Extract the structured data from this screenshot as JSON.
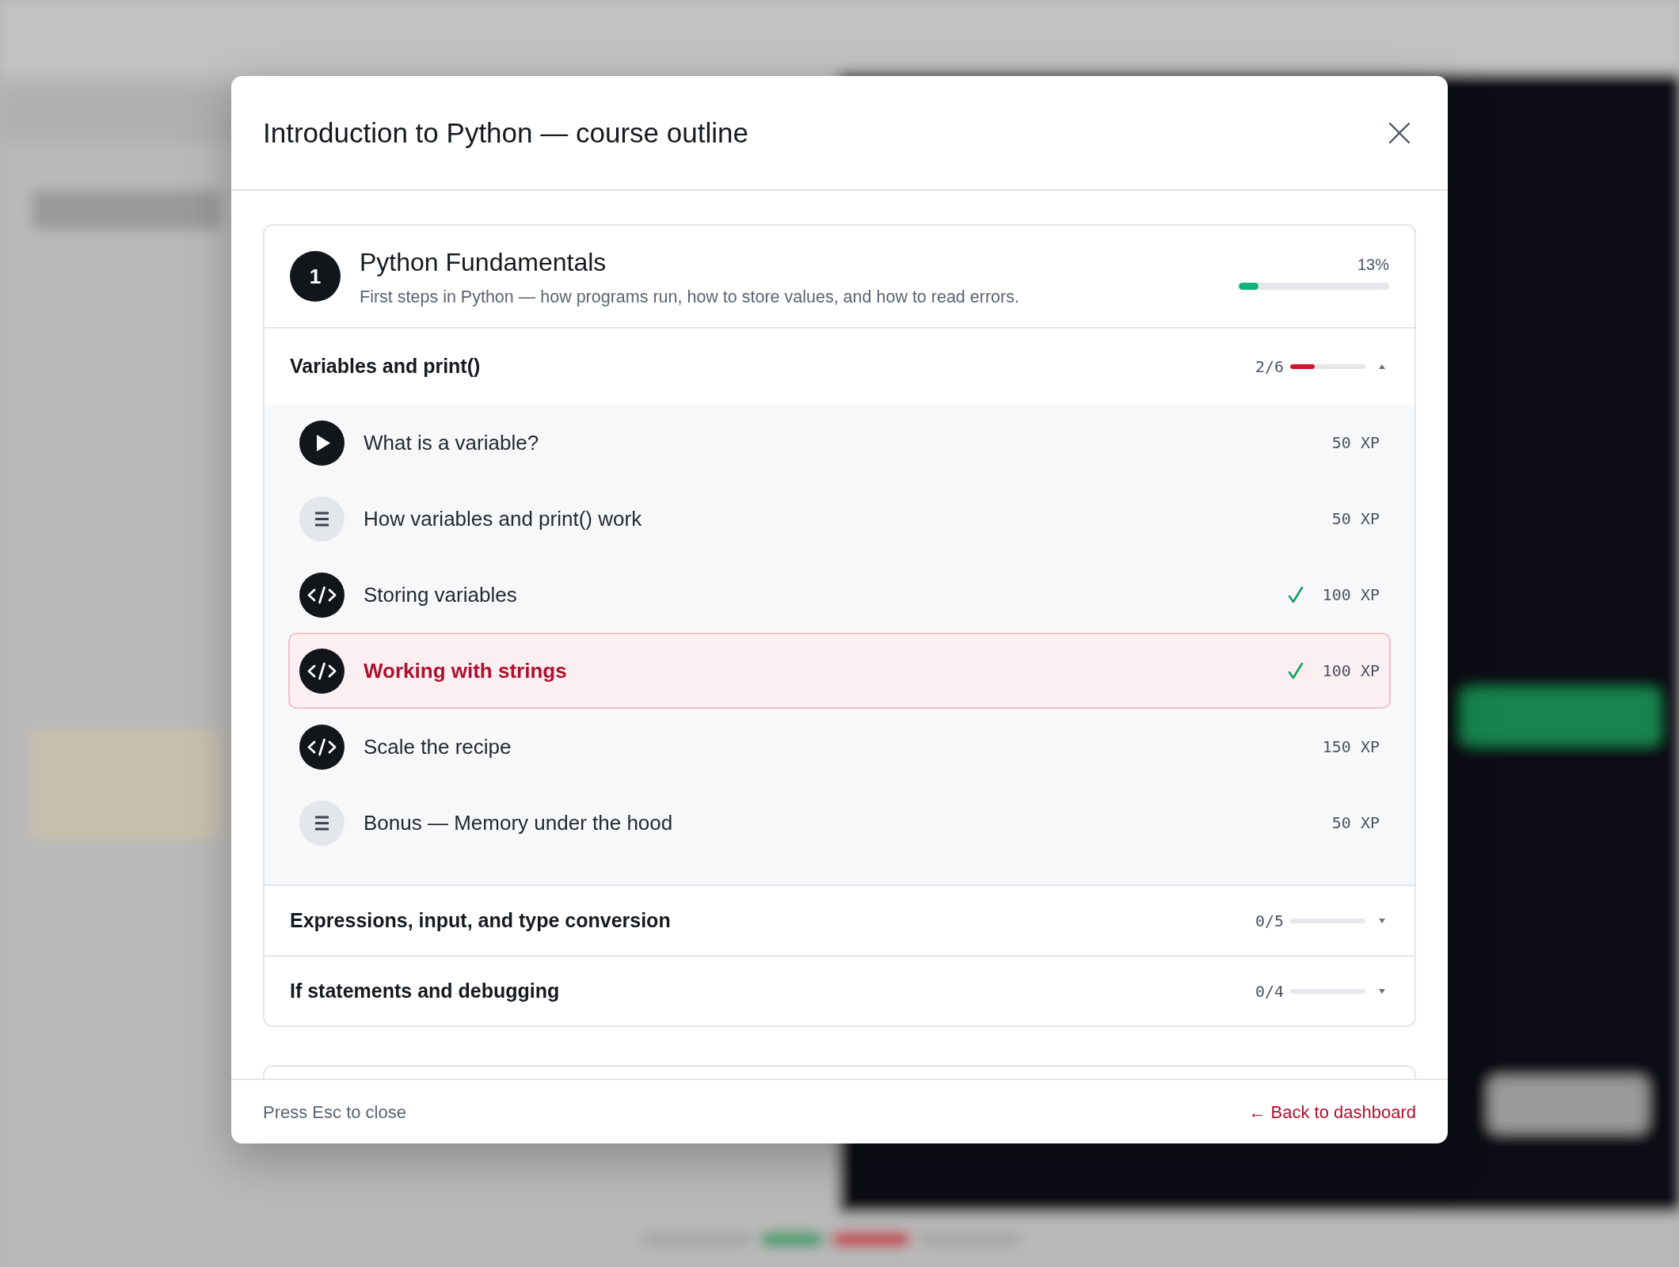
{
  "modal": {
    "title": "Introduction to Python — course outline",
    "footer_hint": "Press Esc to close",
    "footer_link": "← Back to dashboard"
  },
  "chapters": [
    {
      "number": "1",
      "title": "Python Fundamentals",
      "description": "First steps in Python — how programs run, how to store values, and how to read errors.",
      "percent": "13%",
      "level": 0.13,
      "sections": [
        {
          "title": "Variables and print()",
          "count": "2/6",
          "level": 0.33,
          "expanded": true,
          "lessons": [
            {
              "kind": "video",
              "title": "What is a variable?",
              "xp": "50 XP",
              "completed": false,
              "selected": false
            },
            {
              "kind": "article",
              "title": "How variables and print() work",
              "xp": "50 XP",
              "completed": false,
              "selected": false
            },
            {
              "kind": "exercise",
              "title": "Storing variables",
              "xp": "100 XP",
              "completed": true,
              "selected": false
            },
            {
              "kind": "exercise",
              "title": "Working with strings",
              "xp": "100 XP",
              "completed": true,
              "selected": true
            },
            {
              "kind": "exercise",
              "title": "Scale the recipe",
              "xp": "150 XP",
              "completed": false,
              "selected": false
            },
            {
              "kind": "article",
              "title": "Bonus — Memory under the hood",
              "xp": "50 XP",
              "completed": false,
              "selected": false
            }
          ]
        },
        {
          "title": "Expressions, input, and type conversion",
          "count": "0/5",
          "level": 0,
          "expanded": false
        },
        {
          "title": "If statements and debugging",
          "count": "0/4",
          "level": 0,
          "expanded": false
        }
      ]
    }
  ]
}
